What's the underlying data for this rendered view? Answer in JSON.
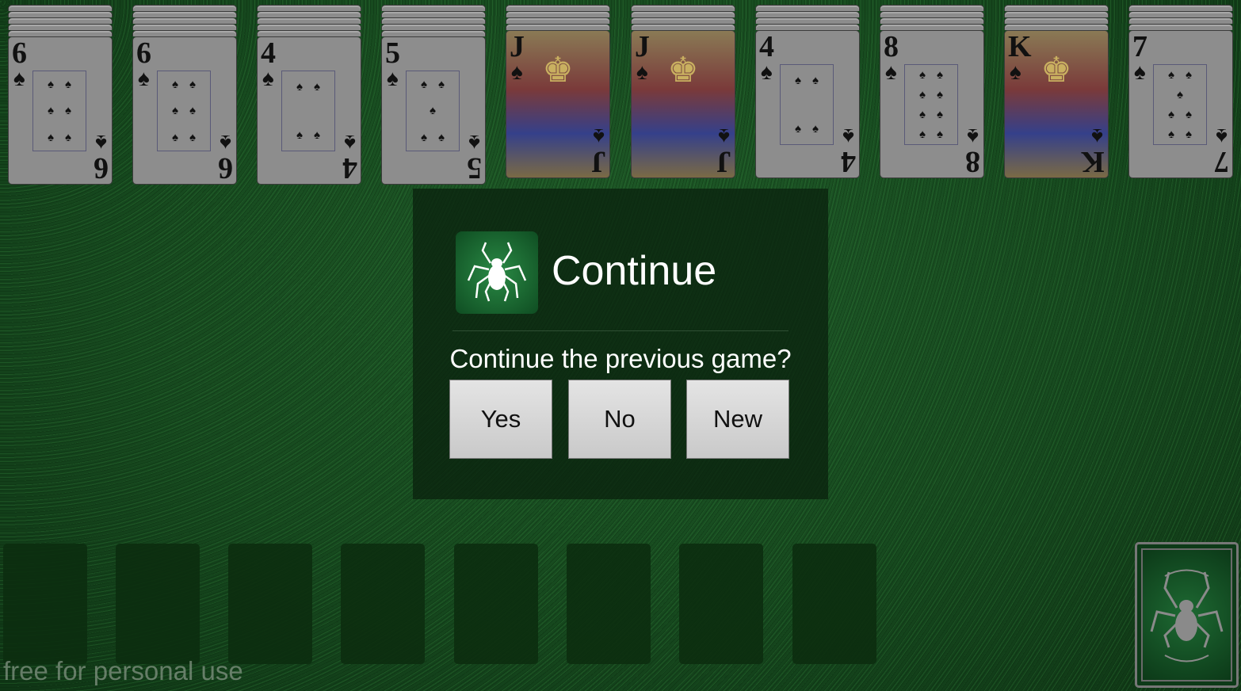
{
  "tableau": [
    {
      "facedown": 5,
      "rank": "6",
      "suit": "♠",
      "pips": [
        2,
        2,
        2
      ]
    },
    {
      "facedown": 5,
      "rank": "6",
      "suit": "♠",
      "pips": [
        2,
        2,
        2
      ]
    },
    {
      "facedown": 5,
      "rank": "4",
      "suit": "♠",
      "pips": [
        2,
        0,
        2
      ]
    },
    {
      "facedown": 5,
      "rank": "5",
      "suit": "♠",
      "pips": [
        2,
        1,
        2
      ]
    },
    {
      "facedown": 4,
      "rank": "J",
      "suit": "♠",
      "face": true
    },
    {
      "facedown": 4,
      "rank": "J",
      "suit": "♠",
      "face": true
    },
    {
      "facedown": 4,
      "rank": "4",
      "suit": "♠",
      "pips": [
        2,
        0,
        2
      ]
    },
    {
      "facedown": 4,
      "rank": "8",
      "suit": "♠",
      "pips": [
        2,
        2,
        2,
        2
      ]
    },
    {
      "facedown": 4,
      "rank": "K",
      "suit": "♠",
      "face": true
    },
    {
      "facedown": 4,
      "rank": "7",
      "suit": "♠",
      "pips": [
        2,
        1,
        2,
        2
      ]
    }
  ],
  "dialog": {
    "title": "Continue",
    "message": "Continue the previous game?",
    "buttons": {
      "yes": "Yes",
      "no": "No",
      "new": "New"
    }
  },
  "foundations_empty": 8,
  "stock": {
    "icon": "spider-icon"
  },
  "footer": "free for personal use"
}
